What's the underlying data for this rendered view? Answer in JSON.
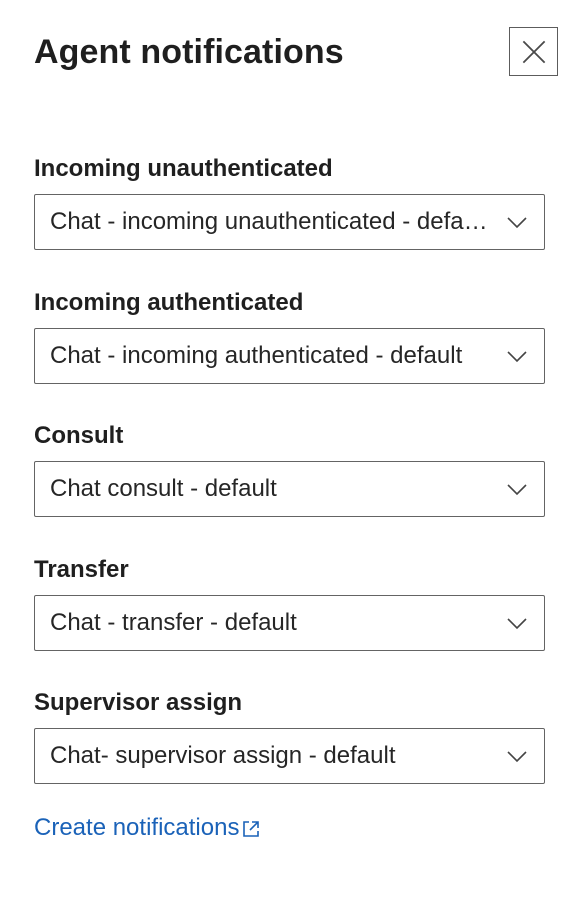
{
  "panel": {
    "title": "Agent notifications",
    "close_icon": "close-icon"
  },
  "fields": [
    {
      "label": "Incoming unauthenticated",
      "value": "Chat - incoming unauthenticated - default",
      "icon": "chevron-down-icon"
    },
    {
      "label": "Incoming authenticated",
      "value": "Chat - incoming authenticated - default",
      "icon": "chevron-down-icon"
    },
    {
      "label": "Consult",
      "value": "Chat consult - default",
      "icon": "chevron-down-icon"
    },
    {
      "label": "Transfer",
      "value": "Chat - transfer - default",
      "icon": "chevron-down-icon"
    },
    {
      "label": "Supervisor assign",
      "value": "Chat- supervisor assign - default",
      "icon": "chevron-down-icon"
    }
  ],
  "link": {
    "label": "Create notifications",
    "icon": "external-link-icon",
    "color": "#1a62b8"
  }
}
